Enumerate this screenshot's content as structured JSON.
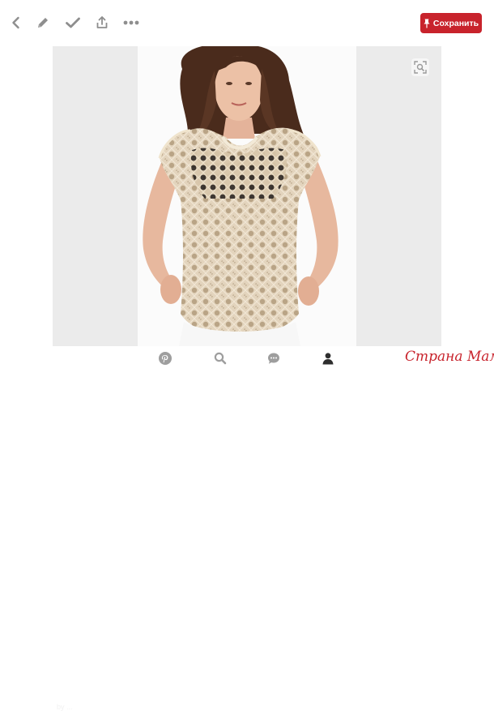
{
  "toolbar": {
    "icons": [
      "chevron-left-icon",
      "pencil-icon",
      "checkmark-icon",
      "share-icon",
      "more-dots-icon"
    ],
    "save_label": "Сохранить",
    "accent_color": "#c8232c"
  },
  "photo": {
    "subject": "Woman wearing beige lace crochet top",
    "visual_search_icon": "lens-icon"
  },
  "bottom_nav": {
    "icons": [
      "pinterest-icon",
      "search-icon",
      "chat-icon",
      "profile-icon"
    ]
  },
  "caption_text": "by ...",
  "watermark_text": "Страна Мам"
}
